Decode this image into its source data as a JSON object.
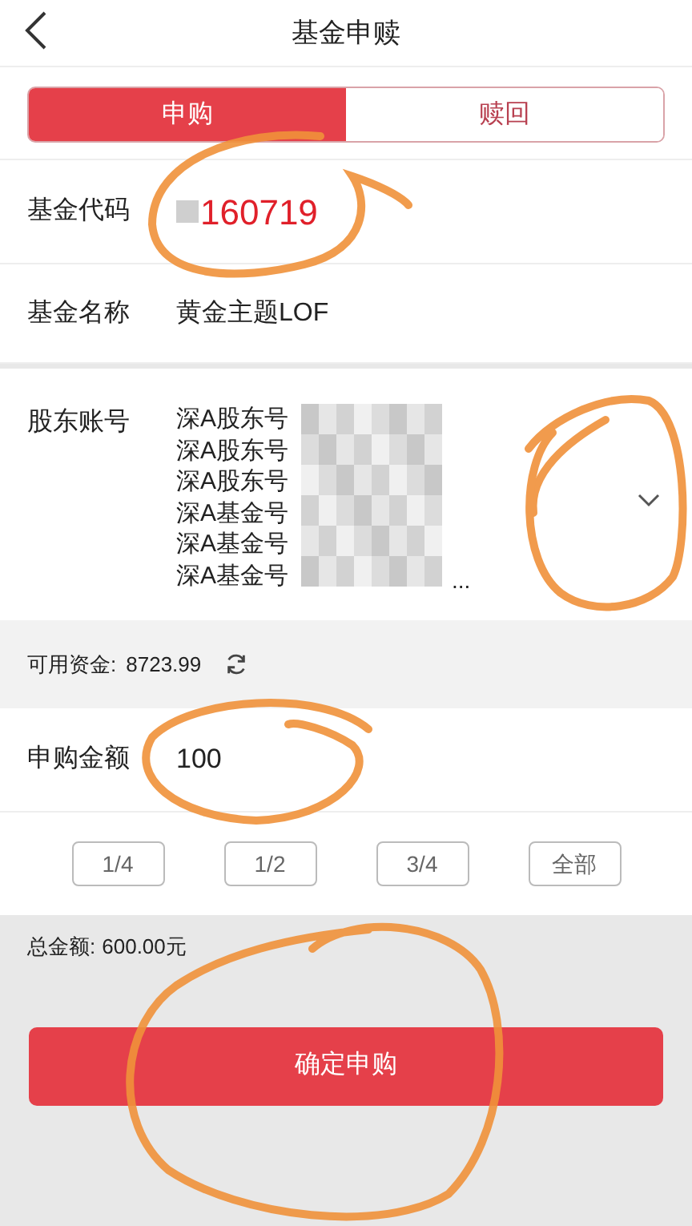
{
  "header": {
    "title": "基金申赎"
  },
  "tabs": [
    {
      "label": "申购",
      "selected": true
    },
    {
      "label": "赎回",
      "selected": false
    }
  ],
  "fund_code": {
    "label": "基金代码",
    "value": "160719"
  },
  "fund_name": {
    "label": "基金名称",
    "value": "黄金主题LOF"
  },
  "shareholder_account": {
    "label": "股东账号",
    "accounts": [
      "深A股东号",
      "深A股东号",
      "深A股东号",
      "深A基金号",
      "深A基金号",
      "深A基金号"
    ],
    "more": "..."
  },
  "available_funds": {
    "label": "可用资金:",
    "value": "8723.99"
  },
  "amount": {
    "label": "申购金额",
    "value": "100"
  },
  "ratio_buttons": [
    "1/4",
    "1/2",
    "3/4",
    "全部"
  ],
  "total": {
    "label": "总金额:",
    "value": "600.00元"
  },
  "confirm_button": "确定申购"
}
